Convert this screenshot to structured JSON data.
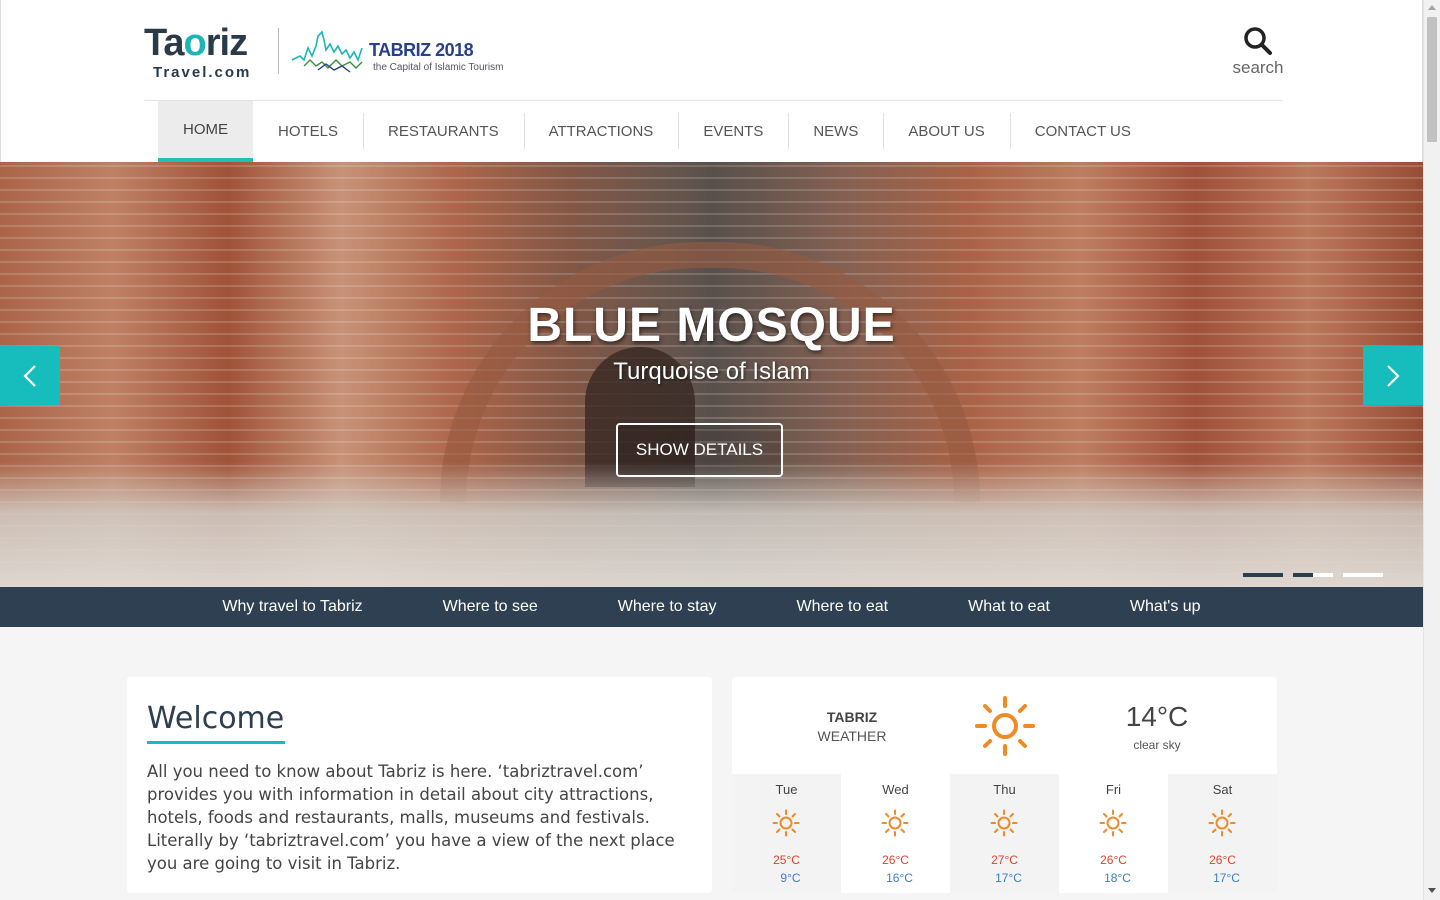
{
  "logo": {
    "brand_main_pre": "Ta",
    "brand_main_mid": "o",
    "brand_main_post": "riz",
    "brand_sub": "Travel.com"
  },
  "event_logo": {
    "title": "TABRIZ 2018",
    "subtitle": "the Capital of Islamic Tourism"
  },
  "search": {
    "label": "search",
    "icon": "search-icon"
  },
  "nav": {
    "items": [
      {
        "label": "HOME",
        "active": true
      },
      {
        "label": "HOTELS"
      },
      {
        "label": "RESTAURANTS"
      },
      {
        "label": "ATTRACTIONS"
      },
      {
        "label": "EVENTS"
      },
      {
        "label": "NEWS"
      },
      {
        "label": "ABOUT US"
      },
      {
        "label": "CONTACT US"
      }
    ]
  },
  "hero": {
    "title": "BLUE MOSQUE",
    "subtitle": "Turquoise of Islam",
    "button": "SHOW DETAILS",
    "prev_icon": "chevron-left-icon",
    "next_icon": "chevron-right-icon",
    "accent": "#17bcbc"
  },
  "subnav": {
    "items": [
      "Why travel to Tabriz",
      "Where to see",
      "Where to stay",
      "Where to eat",
      "What to eat",
      "What's up"
    ]
  },
  "welcome": {
    "title": "Welcome",
    "text": "All you need to know about Tabriz is here. ‘tabriztravel.com’ provides you with information in detail about city attractions, hotels, foods and restaurants, malls, museums and festivals. Literally by ‘tabriztravel.com’ you have a view of the next place you are going to visit in Tabriz."
  },
  "weather": {
    "city": "TABRIZ",
    "label": "WEATHER",
    "temp": "14°C",
    "condition": "clear sky",
    "icon": "sun-icon",
    "forecast": [
      {
        "day": "Tue",
        "high": "25°C",
        "low": "9°C"
      },
      {
        "day": "Wed",
        "high": "26°C",
        "low": "16°C"
      },
      {
        "day": "Thu",
        "high": "27°C",
        "low": "17°C"
      },
      {
        "day": "Fri",
        "high": "26°C",
        "low": "18°C"
      },
      {
        "day": "Sat",
        "high": "26°C",
        "low": "17°C"
      }
    ]
  },
  "colors": {
    "teal": "#17bcbc",
    "navy": "#2e4052",
    "sun": "#f08a24",
    "high": "#d9452c",
    "low": "#3b7fc4"
  }
}
